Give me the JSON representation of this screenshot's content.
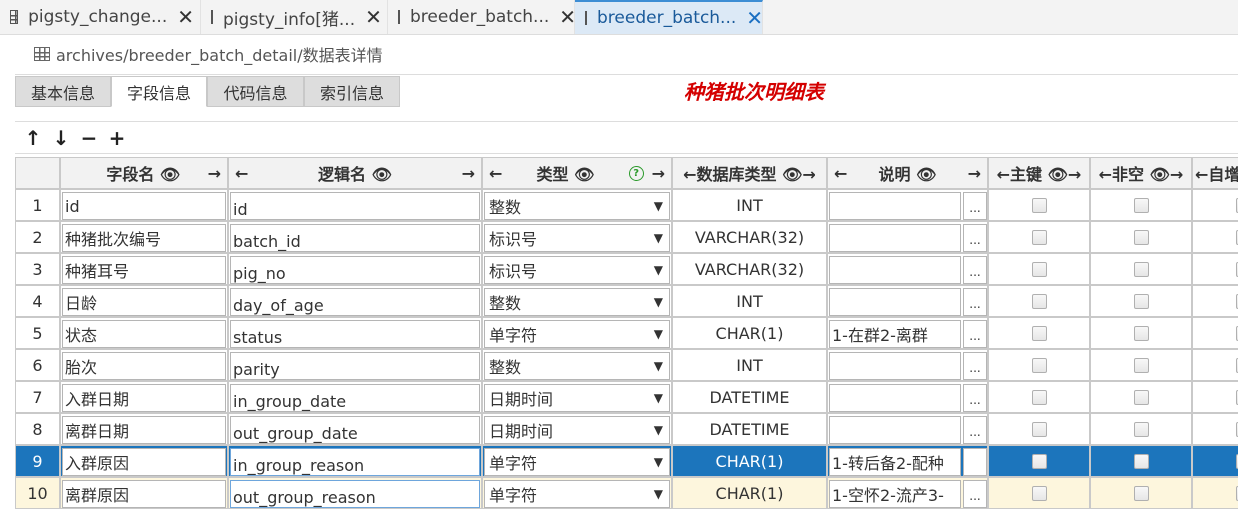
{
  "tabs": [
    {
      "label": "pigsty_change...",
      "close": "✕"
    },
    {
      "label": "pigsty_info[猪...",
      "close": "✕"
    },
    {
      "label": "breeder_batch...",
      "close": "✕"
    },
    {
      "label": "breeder_batch...",
      "close": "✕"
    }
  ],
  "breadcrumb": "archives/breeder_batch_detail/数据表详情",
  "inner_tabs": [
    "基本信息",
    "字段信息",
    "代码信息",
    "索引信息"
  ],
  "table_title": "种猪批次明细表",
  "toolbar": {
    "up": "↑",
    "down": "↓",
    "remove": "−",
    "add": "+"
  },
  "headers": {
    "field_name": "字段名 👁",
    "logic_name": "逻辑名 👁",
    "type": "类型 👁",
    "type_help": "?",
    "db_type": "←数据库类型 👁→",
    "desc": "说明 👁",
    "pk": "←主键 👁→",
    "notnull": "←非空 👁→",
    "auto": "←自增",
    "left": "←",
    "right": "→"
  },
  "rows": [
    {
      "n": "1",
      "field": "id",
      "logic": "id",
      "type": "整数",
      "db": "INT",
      "desc": ""
    },
    {
      "n": "2",
      "field": "种猪批次编号",
      "logic": "batch_id",
      "type": "标识号",
      "db": "VARCHAR(32)",
      "desc": ""
    },
    {
      "n": "3",
      "field": "种猪耳号",
      "logic": "pig_no",
      "type": "标识号",
      "db": "VARCHAR(32)",
      "desc": ""
    },
    {
      "n": "4",
      "field": "日龄",
      "logic": "day_of_age",
      "type": "整数",
      "db": "INT",
      "desc": ""
    },
    {
      "n": "5",
      "field": "状态",
      "logic": "status",
      "type": "单字符",
      "db": "CHAR(1)",
      "desc": "1-在群2-离群"
    },
    {
      "n": "6",
      "field": "胎次",
      "logic": "parity",
      "type": "整数",
      "db": "INT",
      "desc": ""
    },
    {
      "n": "7",
      "field": "入群日期",
      "logic": "in_group_date",
      "type": "日期时间",
      "db": "DATETIME",
      "desc": ""
    },
    {
      "n": "8",
      "field": "离群日期",
      "logic": "out_group_date",
      "type": "日期时间",
      "db": "DATETIME",
      "desc": ""
    },
    {
      "n": "9",
      "field": "入群原因",
      "logic": "in_group_reason",
      "type": "单字符",
      "db": "CHAR(1)",
      "desc": "1-转后备2-配种"
    },
    {
      "n": "10",
      "field": "离群原因",
      "logic": "out_group_reason",
      "type": "单字符",
      "db": "CHAR(1)",
      "desc": "1-空怀2-流产3-"
    }
  ],
  "select_arrow": "▼",
  "ellipsis": "...",
  "colors": {
    "accent": "#1c75bc",
    "title": "#d40000",
    "row_highlight": "#fdf6dd"
  }
}
